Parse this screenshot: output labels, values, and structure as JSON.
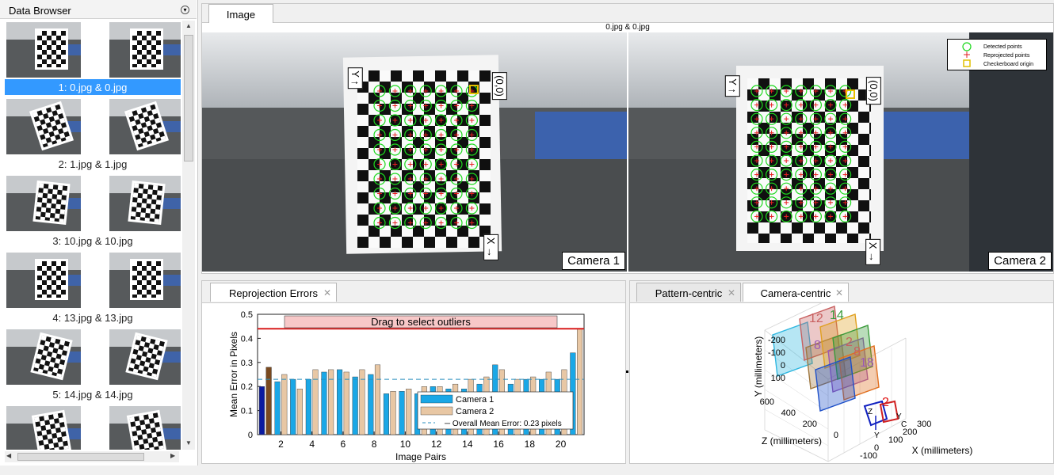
{
  "browser": {
    "title": "Data Browser",
    "pairs": [
      {
        "label": "1: 0.jpg & 0.jpg",
        "selected": true
      },
      {
        "label": "2: 1.jpg & 1.jpg",
        "selected": false
      },
      {
        "label": "3: 10.jpg & 10.jpg",
        "selected": false
      },
      {
        "label": "4: 13.jpg & 13.jpg",
        "selected": false
      },
      {
        "label": "5: 14.jpg & 14.jpg",
        "selected": false
      },
      {
        "label": "",
        "selected": false
      }
    ]
  },
  "image_panel": {
    "tab": "Image",
    "caption": "0.jpg & 0.jpg",
    "camera1_label": "Camera 1",
    "camera2_label": "Camera 2",
    "origin_label": "(0,0)",
    "x_axis_label": "X",
    "y_axis_label": "Y",
    "legend": {
      "detected": "Detected points",
      "reprojected": "Reprojected points",
      "origin": "Checkerboard origin"
    }
  },
  "reprojection": {
    "tab": "Reprojection Errors",
    "drag_label": "Drag to select outliers",
    "legend_cam1": "Camera 1",
    "legend_cam2": "Camera 2",
    "legend_mean": "Overall Mean Error: 0.23 pixels",
    "colors": {
      "camera1": "#1aa7e6",
      "camera2": "#e8c7a4",
      "outline": "#d81e1e"
    }
  },
  "camera_centric": {
    "tabs": [
      "Pattern-centric",
      "Camera-centric"
    ],
    "active_tab": "Camera-centric",
    "ylabel": "Y (millimeters)",
    "zlabel": "Z (millimeters)",
    "xlabel": "X (millimeters)",
    "y_ticks": [
      "-200",
      "-100",
      "0",
      "100"
    ],
    "z_ticks": [
      "600",
      "400",
      "200",
      "0"
    ],
    "x_ticks": [
      "-100",
      "0",
      "100",
      "200",
      "300"
    ],
    "pattern_numbers": [
      "12",
      "14",
      "8",
      "18",
      "8",
      "2",
      "2"
    ],
    "camera_labels": [
      "Y",
      "Z",
      "Y",
      "C"
    ]
  },
  "chart_data": {
    "type": "bar",
    "title": "",
    "xlabel": "Image Pairs",
    "ylabel": "Mean Error in Pixels",
    "ylim": [
      0,
      0.5
    ],
    "yticks": [
      0,
      0.1,
      0.2,
      0.3,
      0.4,
      0.5
    ],
    "xticks": [
      2,
      4,
      6,
      8,
      10,
      12,
      14,
      16,
      18,
      20
    ],
    "categories": [
      1,
      2,
      3,
      4,
      5,
      6,
      7,
      8,
      9,
      10,
      11,
      12,
      13,
      14,
      15,
      16,
      17,
      18,
      19,
      20,
      21
    ],
    "series": [
      {
        "name": "Camera 1",
        "values": [
          0.2,
          0.22,
          0.23,
          0.23,
          0.26,
          0.27,
          0.24,
          0.25,
          0.17,
          0.18,
          0.17,
          0.2,
          0.19,
          0.19,
          0.21,
          0.29,
          0.21,
          0.23,
          0.23,
          0.23,
          0.34
        ]
      },
      {
        "name": "Camera 2",
        "values": [
          0.28,
          0.25,
          0.19,
          0.27,
          0.27,
          0.26,
          0.27,
          0.29,
          0.18,
          0.19,
          0.2,
          0.2,
          0.21,
          0.23,
          0.24,
          0.27,
          0.23,
          0.24,
          0.26,
          0.27,
          0.44
        ]
      }
    ],
    "overall_mean": 0.23,
    "outlier_threshold": 0.44,
    "legend_position": "bottom-right"
  }
}
